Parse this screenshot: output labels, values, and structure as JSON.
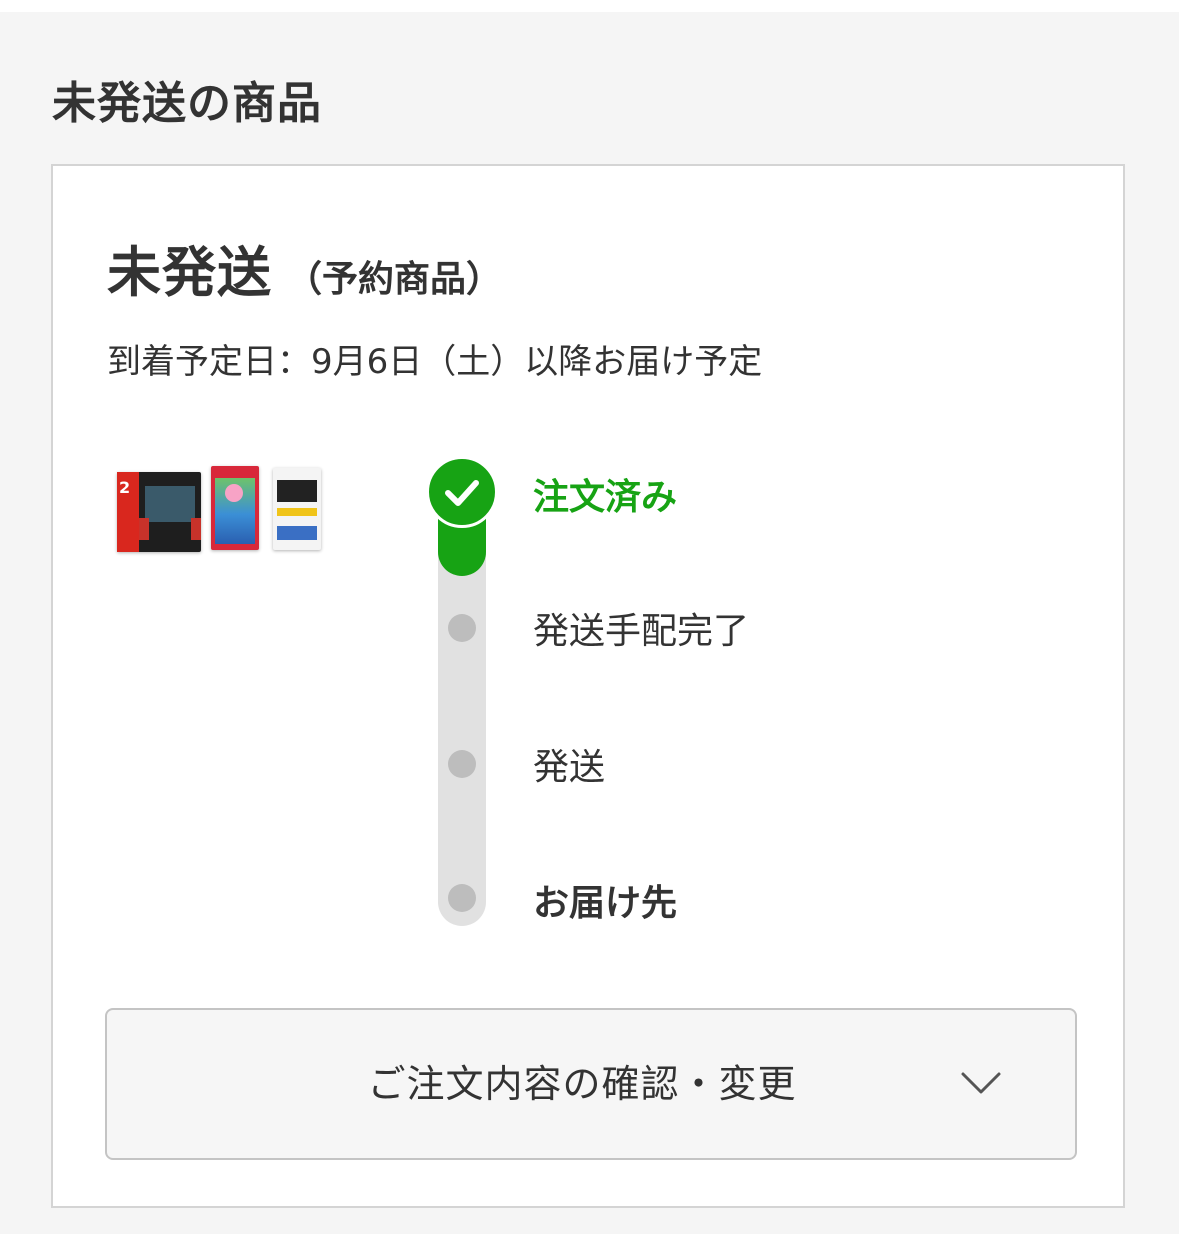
{
  "section": {
    "title": "未発送の商品"
  },
  "order": {
    "status": "未発送",
    "status_note": "（予約商品）",
    "delivery_date": "到着予定日：9月6日（土）以降お届け予定",
    "thumbnails": [
      {
        "label": "2",
        "kind": "console"
      },
      {
        "kind": "game"
      },
      {
        "kind": "screen-film"
      }
    ],
    "progress": {
      "current_step_index": 0,
      "steps": [
        {
          "label": "注文済み",
          "state": "done"
        },
        {
          "label": "発送手配完了",
          "state": "pending"
        },
        {
          "label": "発送",
          "state": "pending"
        },
        {
          "label": "お届け先",
          "state": "pending"
        }
      ]
    },
    "confirm_button": {
      "label": "ご注文内容の確認・変更",
      "icon": "chevron-down-icon"
    }
  },
  "colors": {
    "accent_green": "#17a314",
    "track_gray": "#e1e1e1",
    "dot_gray": "#bdbdbd"
  }
}
